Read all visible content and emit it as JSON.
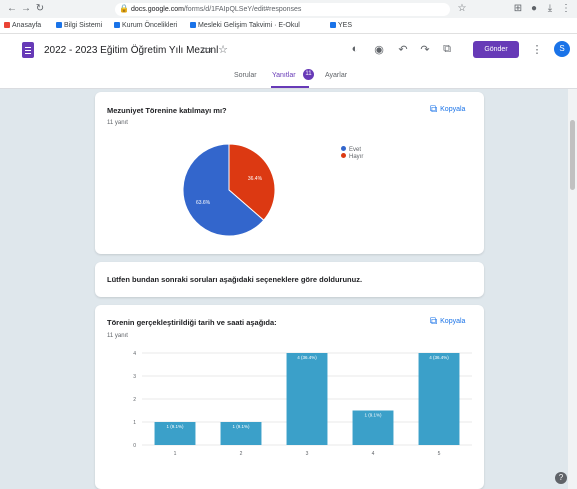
{
  "browser": {
    "url_host": "docs.google.com",
    "url_path": "/forms/d/1FAIpQLSeY/edit#responses",
    "bookmarks": [
      {
        "label": "Anasayfa",
        "color": "#ea4335"
      },
      {
        "label": "Bilgi Sistemi",
        "color": "#1a73e8"
      },
      {
        "label": "Kurum Öncelikleri",
        "color": "#1a73e8"
      },
      {
        "label": "Mesleki Gelişim Takvimi · E-Okul",
        "color": "#1a73e8"
      },
      {
        "label": "YES",
        "color": "#1a73e8"
      }
    ]
  },
  "header": {
    "title": "2022 - 2023 Eğitim Öğretim Yılı Mezunl",
    "send_label": "Gönder",
    "avatar_letter": "S"
  },
  "tabs": [
    {
      "label": "Sorular"
    },
    {
      "label": "Yanıtlar",
      "badge": "11"
    },
    {
      "label": "Ayarlar"
    }
  ],
  "questions": {
    "q1": {
      "title": "Mezuniyet Törenine katılmayı mı?",
      "count_label": "11 yanıt",
      "copy_label": "Kopyala"
    },
    "section": {
      "title": "Lütfen bundan sonraki soruları aşağıdaki seçeneklere göre doldurunuz."
    },
    "q2": {
      "title": "Törenin gerçekleştirildiği tarih ve saati aşağıda:",
      "count_label": "11 yanıt",
      "copy_label": "Kopyala"
    }
  },
  "chart_data": [
    {
      "type": "pie",
      "slices": [
        {
          "label": "Evet",
          "value": 63.6,
          "color": "#3366cc",
          "label_text": "63.6%"
        },
        {
          "label": "Hayır",
          "value": 36.4,
          "color": "#dc3912",
          "label_text": "36.4%"
        }
      ],
      "legend": "right"
    },
    {
      "type": "bar",
      "categories": [
        "1",
        "2",
        "3",
        "4",
        "5"
      ],
      "values": [
        1,
        1,
        4,
        1.5,
        4
      ],
      "value_labels": [
        "1 (9.1%)",
        "1 (9.1%)",
        "4 (36.4%)",
        "1 (9.1%)",
        "4 (36.4%)"
      ],
      "ylim": [
        0,
        4
      ],
      "yticks": [
        "0",
        "1",
        "2",
        "3",
        "4"
      ],
      "grid": true,
      "color": "#3ba0c9"
    }
  ],
  "help_label": "?"
}
